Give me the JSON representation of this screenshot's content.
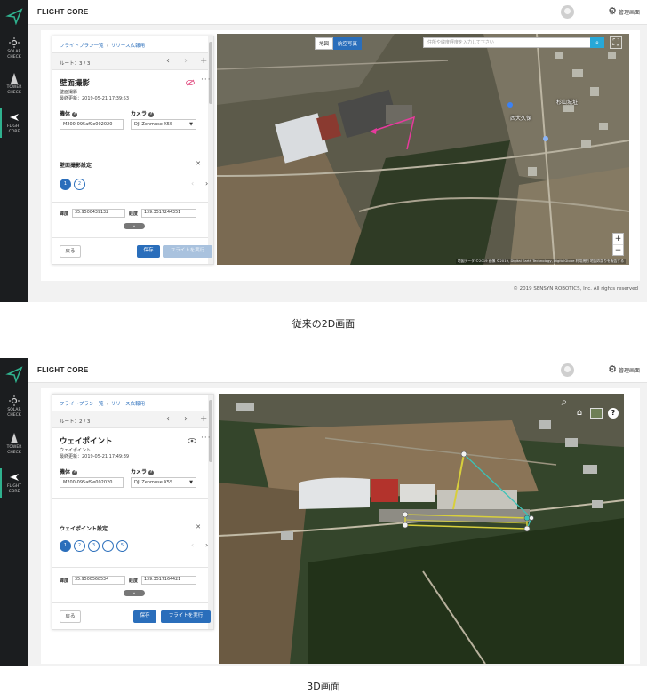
{
  "colors": {
    "accent": "#2a6ebb",
    "sidebar_bg": "#1b1d1f",
    "sidebar_active": "#2fb18e",
    "route_line": "#e83a9e",
    "path3d_yellow": "#d8cf3c",
    "path3d_teal": "#3cc3b8"
  },
  "screen2d": {
    "brand": "FLIGHT CORE",
    "admin_label": "管理画面",
    "sidebar": [
      {
        "label1": "SOLAR",
        "label2": "CHECK",
        "icon": "sun-icon"
      },
      {
        "label1": "TOWER",
        "label2": "CHECK",
        "icon": "tower-icon"
      },
      {
        "label1": "FLIGHT",
        "label2": "CORE",
        "icon": "airplane-icon"
      }
    ],
    "breadcrumb": [
      "フライトプラン一覧",
      "リリース広報用"
    ],
    "route": "ルート：3 / 3",
    "title": "壁面撮影",
    "subtitle": "壁面撮影",
    "updated": "最終更新：2019-05-21 17:39:53",
    "aircraft_label": "機体",
    "aircraft_value": "M200-095af9e002020",
    "camera_label": "カメラ",
    "camera_value": "DJI Zenmuse X5S",
    "settings_title": "壁面撮影設定",
    "steps": [
      "1",
      "2"
    ],
    "lat_label": "緯度",
    "lat_value": "35.9500439132",
    "lng_label": "経度",
    "lng_value": "139.3517244351",
    "btn_back": "戻る",
    "btn_save": "保存",
    "btn_exec": "フライトを実行",
    "map_toggle": [
      "地図",
      "航空写真"
    ],
    "map_search_placeholder": "住所や緯度経度を入力して下さい",
    "place1": "杉山城址",
    "place2": "西大久保",
    "attribution": "地図データ ©2019 画像 ©2019, Digital Earth Technology, DigitalGlobe 利用規約 地図の誤りを報告する",
    "copyright": "© 2019 SENSYN ROBOTICS, Inc. All rights reserved"
  },
  "caption2d": "従来の2D画面",
  "screen3d": {
    "brand": "FLIGHT CORE",
    "admin_label": "管理画面",
    "sidebar": [
      {
        "label1": "SOLAR",
        "label2": "CHECK",
        "icon": "sun-icon"
      },
      {
        "label1": "TOWER",
        "label2": "CHECK",
        "icon": "tower-icon"
      },
      {
        "label1": "FLIGHT",
        "label2": "CORE",
        "icon": "airplane-icon"
      }
    ],
    "breadcrumb": [
      "フライトプラン一覧",
      "リリース広報用"
    ],
    "route": "ルート：2 / 3",
    "title": "ウェイポイント",
    "subtitle": "ウェイポイント",
    "updated": "最終更新：2019-05-21 17:49:39",
    "aircraft_label": "機体",
    "aircraft_value": "M200-095af9e002020",
    "camera_label": "カメラ",
    "camera_value": "DJI Zenmuse X5S",
    "settings_title": "ウェイポイント設定",
    "steps": [
      "1",
      "2",
      "3",
      "...",
      "5"
    ],
    "lat_label": "緯度",
    "lat_value": "35.9500568534",
    "lng_label": "経度",
    "lng_value": "139.3517164421",
    "btn_back": "戻る",
    "btn_save": "保存",
    "btn_exec": "フライトを実行"
  },
  "caption3d": "3D画面"
}
